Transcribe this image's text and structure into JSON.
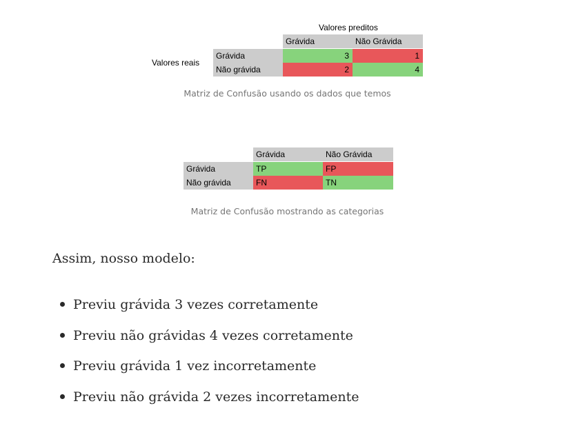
{
  "table1": {
    "predicted_header": "Valores preditos",
    "real_header": "Valores reais",
    "col_labels": [
      "Grávida",
      "Não Grávida"
    ],
    "row_labels": [
      "Grávida",
      "Não grávida"
    ],
    "cells": [
      [
        "3",
        "1"
      ],
      [
        "2",
        "4"
      ]
    ],
    "caption": "Matriz de Confusão usando os dados que temos"
  },
  "table2": {
    "col_labels": [
      "Grávida",
      "Não Grávida"
    ],
    "row_labels": [
      "Grávida",
      "Não grávida"
    ],
    "cells": [
      [
        "TP",
        "FP"
      ],
      [
        "FN",
        "TN"
      ]
    ],
    "caption": "Matriz de Confusão mostrando as categorias"
  },
  "colors": {
    "correct": "#87d37c",
    "incorrect": "#e8575a",
    "header": "#cccccc"
  },
  "intro": "Assim, nosso modelo:",
  "bullets": [
    "Previu grávida 3 vezes corretamente",
    "Previu não grávidas 4 vezes corretamente",
    "Previu grávida 1 vez incorretamente",
    "Previu não grávida 2 vezes incorretamente"
  ]
}
